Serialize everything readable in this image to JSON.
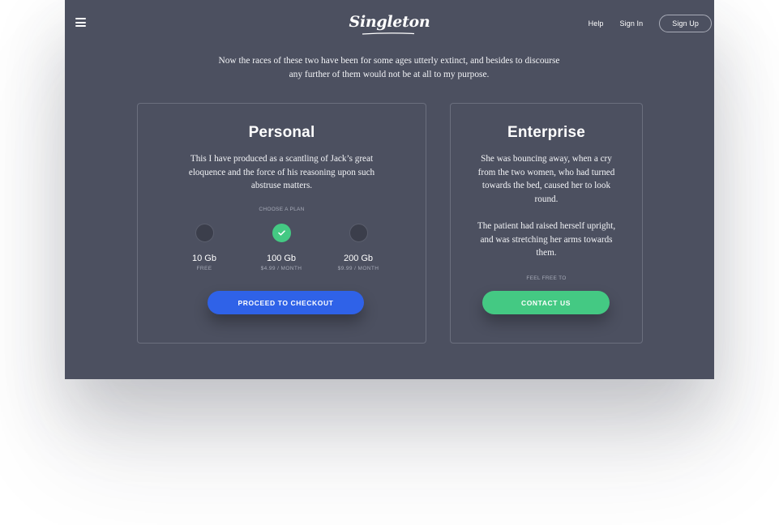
{
  "header": {
    "logo": "Singleton",
    "nav": [
      {
        "label": "Help"
      },
      {
        "label": "Sign In"
      }
    ],
    "signup_label": "Sign Up"
  },
  "intro": {
    "line1": "Now the races of these two have been for some ages utterly extinct, and besides to discourse",
    "line2": "any further of them would not be at all to my purpose."
  },
  "personal": {
    "title": "Personal",
    "description": "This I have produced as a scantling of Jack’s great eloquence and the force of his reasoning upon such abstruse matters.",
    "choose_label": "CHOOSE A PLAN",
    "plans": [
      {
        "size": "10 Gb",
        "price": "FREE",
        "selected": false
      },
      {
        "size": "100 Gb",
        "price": "$4.99 / MONTH",
        "selected": true
      },
      {
        "size": "200 Gb",
        "price": "$9.99 / MONTH",
        "selected": false
      }
    ],
    "button": "PROCEED TO CHECKOUT"
  },
  "enterprise": {
    "title": "Enterprise",
    "description1": "She was bouncing away, when a cry from the two women, who had turned towards the bed, caused her to look round.",
    "description2": "The patient had raised herself upright, and was stretching her arms towards them.",
    "free_label": "FEEL FREE TO",
    "button": "CONTACT US"
  },
  "colors": {
    "background": "#4c5060",
    "primary_button": "#2f62e8",
    "success": "#44c983"
  },
  "icons": {
    "menu": "hamburger-icon",
    "selected": "check-icon"
  }
}
